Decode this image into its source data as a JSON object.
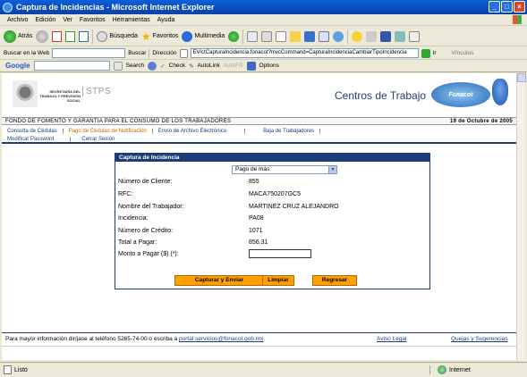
{
  "window": {
    "title": "Captura de Incidencias - Microsoft Internet Explorer"
  },
  "menubar": [
    "Archivo",
    "Edición",
    "Ver",
    "Favoritos",
    "Herramientas",
    "Ayuda"
  ],
  "toolbar": {
    "back": "Atrás",
    "search": "Búsqueda",
    "favorites": "Favoritos",
    "media": "Multimedia"
  },
  "address": {
    "search_label": "Buscar en la Web",
    "buscar": "Buscar",
    "direccion": "Dirección",
    "url": "EV/ctCapturaIncidencia.fonacot?mvcCommand=CapturaIncidenciaCambiarTipoIncidencia",
    "go": "Ir",
    "vinculos": "Vínculos"
  },
  "google": {
    "logo": "Google",
    "search": "Search",
    "check": "Check",
    "autolink": "AutoLink",
    "autofill": "AutoFill",
    "options": "Options"
  },
  "header": {
    "secretaria": "SECRETARÍA DEL TRABAJO Y PREVISIÓN SOCIAL",
    "stps": "STPS",
    "centros": "Centros de Trabajo",
    "fonacot": "Fonacot"
  },
  "fund": {
    "name": "FONDO DE FOMENTO Y GARANTIA PARA EL CONSUMO DE LOS TRABAJADORES",
    "date": "19 de Octubre de 2005"
  },
  "nav": {
    "row1": [
      "Consulta de Cédulas",
      "Pago de Cédulas de Notificación",
      "Envío de Archivo Electrónico",
      "Baja de Trabajadores"
    ],
    "row2": [
      "Modificar Password",
      "Cerrar Sesión"
    ]
  },
  "form": {
    "title": "Captura de Incidencia",
    "select_value": "Pago de más",
    "fields": [
      {
        "label": "Número de Cliente:",
        "value": "855"
      },
      {
        "label": "RFC:",
        "value": "MACA750207GC5"
      },
      {
        "label": "Nombre del Trabajador:",
        "value": "MARTINEZ CRUZ ALEJANDRO"
      },
      {
        "label": "Incidencia:",
        "value": "PA08"
      },
      {
        "label": "Número de Crédito:",
        "value": "1071"
      },
      {
        "label": "Total a Pagar:",
        "value": "856.31"
      }
    ],
    "amount_label": "Monto a Pagar ($) (*):",
    "amount_value": "",
    "buttons": {
      "submit": "Capturar y Enviar",
      "clear": "Limpiar",
      "back": "Regresar"
    }
  },
  "footer": {
    "text": "Para mayor información diríjase al teléfono 5265-74-00 o escriba a",
    "email": "portal.servicios@fonacot.gob.mx",
    "aviso": "Aviso Legal",
    "quejas": "Quejas y Sugerencias"
  },
  "status": {
    "ready": "Listo",
    "zone": "Internet"
  }
}
